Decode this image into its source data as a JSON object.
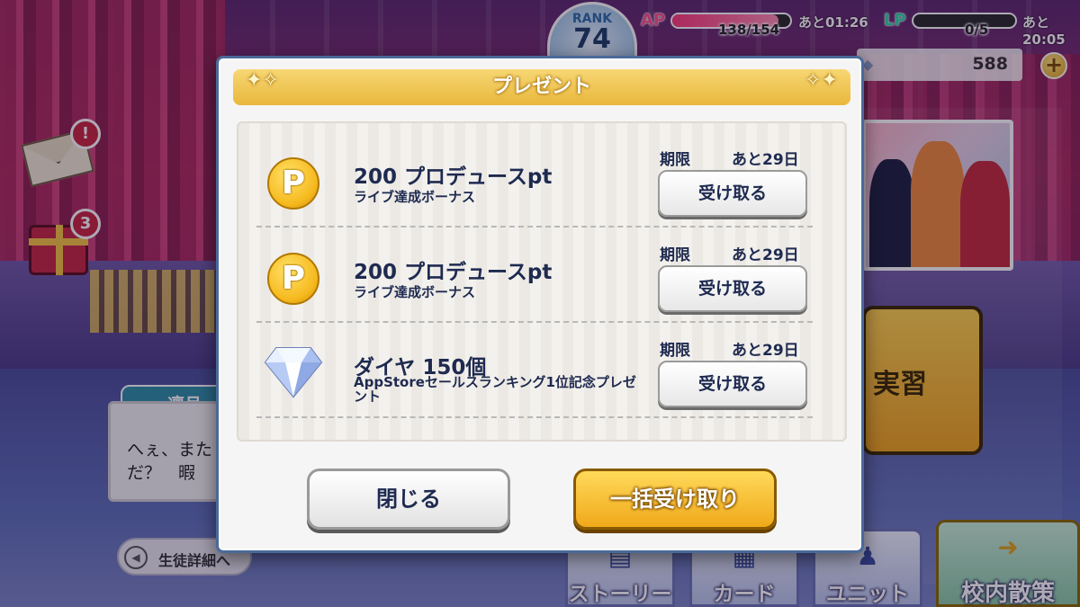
{
  "status_bar": {
    "rank_label": "RANK",
    "rank_value": "74",
    "ap_label": "AP",
    "ap_count": "138/154",
    "ap_fill_fraction": 0.9,
    "ap_timer": "あと01:26",
    "lp_label": "LP",
    "lp_count": "0/5",
    "lp_fill_fraction": 0,
    "lp_timer": "あと20:05",
    "currency_value": "588",
    "currency_add": "+"
  },
  "side_icons": {
    "mail_badge": "!",
    "gift_badge": "3"
  },
  "background": {
    "char_name": "凛月",
    "dialog_text_line1": "へぇ、また",
    "dialog_text_line2": "だ？　暇",
    "back_label": "生徒詳細へ",
    "back_icon": "◀",
    "practice_label": "実習",
    "nav": {
      "story": "ストーリー",
      "card": "カード",
      "unit": "ユニット",
      "walk": "校内散策"
    }
  },
  "modal": {
    "title": "プレゼント",
    "sparkle_left": "✦✧",
    "sparkle_right": "✧✦",
    "items": [
      {
        "icon": "P",
        "title": "200 プロデュースpt",
        "subtitle": "ライブ達成ボーナス",
        "deadline_label": "期限",
        "deadline_value": "あと29日",
        "button_label": "受け取る"
      },
      {
        "icon": "P",
        "title": "200 プロデュースpt",
        "subtitle": "ライブ達成ボーナス",
        "deadline_label": "期限",
        "deadline_value": "あと29日",
        "button_label": "受け取る"
      },
      {
        "icon": "diamond",
        "title": "ダイヤ 150個",
        "subtitle": "AppStoreセールスランキング1位記念プレゼント",
        "deadline_label": "期限",
        "deadline_value": "あと29日",
        "button_label": "受け取る"
      }
    ],
    "close_label": "閉じる",
    "receive_all_label": "一括受け取り"
  },
  "colors": {
    "header_gold": "#e9b73c",
    "button_gold": "#f0a91a",
    "text_navy": "#1e2a50",
    "ap_pink": "#ff4f8b",
    "lp_green": "#2fd6a3",
    "badge_red": "#c8263e"
  }
}
